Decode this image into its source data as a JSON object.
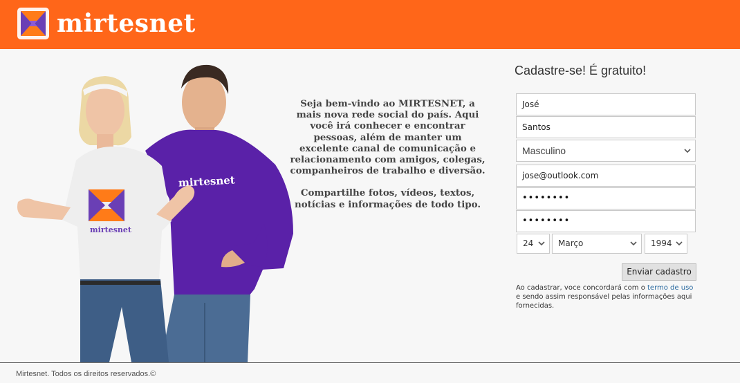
{
  "header": {
    "brand": "mirtesnet",
    "brand_color": "#ff6619"
  },
  "hero": {
    "shirt_text_left": "mirtesnet",
    "shirt_text_right": "mirtesnet"
  },
  "intro": {
    "paragraph1": "Seja bem-vindo ao MIRTESNET, a  mais nova rede social do país. Aqui você irá conhecer e encontrar  pessoas, além de manter um  excelente canal de comunicação e  relacionamento com amigos,  colegas, companheiros de trabalho e  diversão.",
    "paragraph2": "Compartilhe fotos, vídeos, textos, notícias e informações de todo tipo."
  },
  "signup": {
    "title": "Cadastre-se! É gratuito!",
    "first_name": "José",
    "last_name": "Santos",
    "gender": "Masculino",
    "email": "jose@outlook.com",
    "password_mask": "••••••••",
    "confirm_mask": "••••••••",
    "birth_day": "24",
    "birth_month": "Março",
    "birth_year": "1994",
    "submit_label": "Enviar cadastro",
    "terms_before": "Ao cadastrar, voce concordará com o ",
    "terms_link": "termo de uso",
    "terms_after": " e sendo assim responsável pelas informações aqui fornecidas."
  },
  "footer": {
    "text": "Mirtesnet. Todos os direitos reservados.©"
  }
}
